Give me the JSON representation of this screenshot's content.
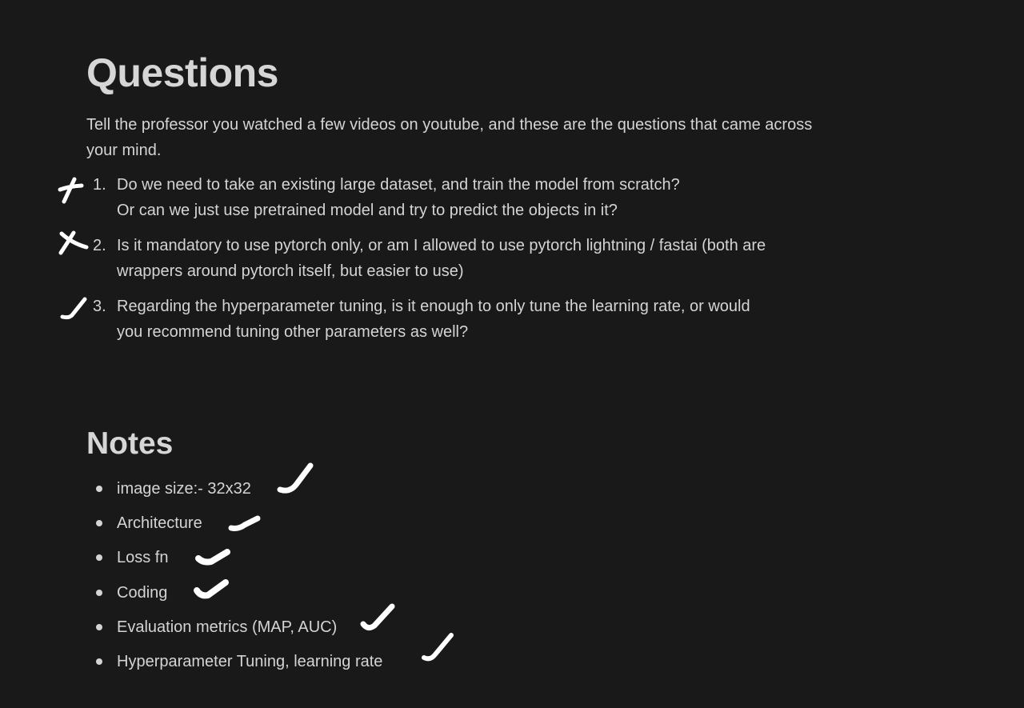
{
  "questions": {
    "heading": "Questions",
    "intro": "Tell the professor you watched a few videos on youtube, and these are the questions that came across your mind.",
    "items": [
      {
        "number": "1.",
        "lines": [
          "Do we need to take an existing large dataset, and train the model from scratch?",
          "Or can we just use pretrained model and try to predict the objects in it?"
        ],
        "mark": "cross-mark"
      },
      {
        "number": "2.",
        "lines": [
          "Is it mandatory to use pytorch only, or am I allowed to use pytorch lightning / fastai (both are",
          "wrappers around pytorch itself, but easier to use)"
        ],
        "mark": "cross-mark"
      },
      {
        "number": "3.",
        "lines": [
          "Regarding the hyperparameter tuning, is it enough to only tune the learning rate, or would",
          "you recommend tuning other parameters as well?"
        ],
        "mark": "check-mark"
      }
    ]
  },
  "notes": {
    "heading": "Notes",
    "items": [
      {
        "text": "image size:- 32x32",
        "mark": "check-mark"
      },
      {
        "text": "Architecture",
        "mark": "check-mark"
      },
      {
        "text": "Loss fn",
        "mark": "check-mark"
      },
      {
        "text": "Coding",
        "mark": "check-mark"
      },
      {
        "text": "Evaluation metrics (MAP, AUC)",
        "mark": "check-mark"
      },
      {
        "text": "Hyperparameter Tuning, learning rate",
        "mark": "check-mark"
      }
    ]
  },
  "colors": {
    "background": "#191919",
    "text": "#d4d4d4",
    "heading": "#d6d6d6",
    "ink": "#ffffff"
  }
}
